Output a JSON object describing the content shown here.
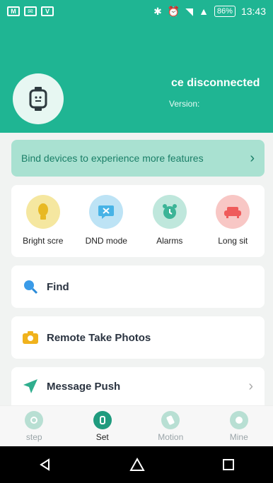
{
  "status_bar": {
    "notif_icons": [
      "M",
      "mail",
      "V"
    ],
    "battery": "86%",
    "time": "13:43"
  },
  "header": {
    "connection_status": "ce disconnected",
    "version_label": "Version:"
  },
  "bind_banner": {
    "text": "Bind devices to experience more features"
  },
  "features": [
    {
      "label": "Bright scre",
      "color": "#f5e7a0",
      "icon": "bulb-icon"
    },
    {
      "label": "DND mode",
      "color": "#bde3f5",
      "icon": "dnd-icon"
    },
    {
      "label": "Alarms",
      "color": "#bfe7dc",
      "icon": "alarm-icon"
    },
    {
      "label": "Long sit",
      "color": "#f8c7c5",
      "icon": "sofa-icon"
    }
  ],
  "rows": [
    {
      "label": "Find",
      "icon": "search-icon"
    },
    {
      "label": "Remote Take Photos",
      "icon": "camera-icon"
    },
    {
      "label": "Message Push",
      "icon": "send-icon"
    }
  ],
  "tabs": [
    {
      "label": "step",
      "icon": "step-icon",
      "active": false
    },
    {
      "label": "Set",
      "icon": "watch-icon",
      "active": true
    },
    {
      "label": "Motion",
      "icon": "motion-icon",
      "active": false
    },
    {
      "label": "Mine",
      "icon": "person-icon",
      "active": false
    }
  ],
  "colors": {
    "brand": "#1fb593",
    "banner": "#a9e1d1"
  }
}
